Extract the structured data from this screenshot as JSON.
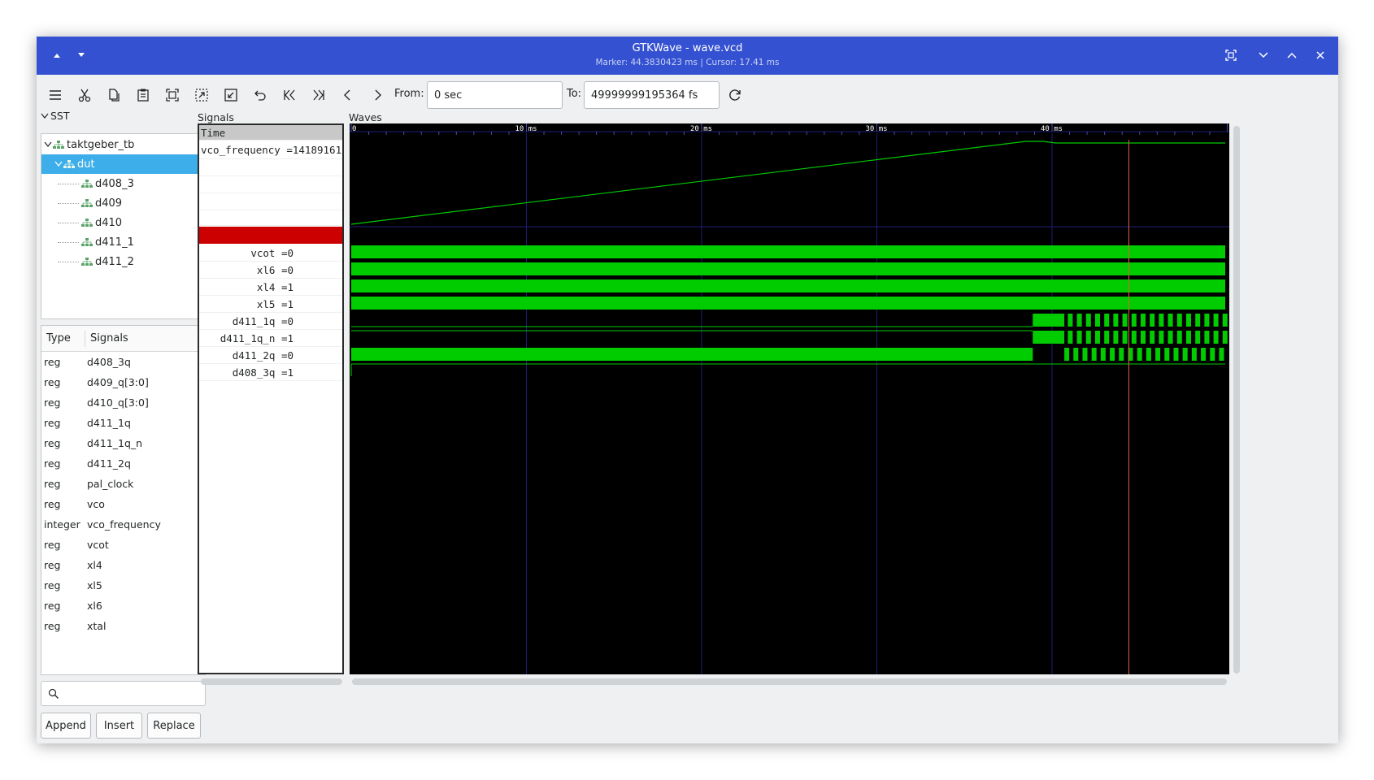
{
  "window": {
    "title": "GTKWave - wave.vcd",
    "subtitle": "Marker: 44.3830423 ms  |  Cursor: 17.41 ms"
  },
  "toolbar": {
    "from_label": "From:",
    "from_value": "0 sec",
    "to_label": "To:",
    "to_value": "49999999195364 fs"
  },
  "sst": {
    "label": "SST",
    "tree": [
      {
        "label": "taktgeber_tb",
        "level": 0,
        "expanded": true,
        "selected": false
      },
      {
        "label": "dut",
        "level": 1,
        "expanded": true,
        "selected": true
      },
      {
        "label": "d408_3",
        "level": 2,
        "selected": false
      },
      {
        "label": "d409",
        "level": 2,
        "selected": false
      },
      {
        "label": "d410",
        "level": 2,
        "selected": false
      },
      {
        "label": "d411_1",
        "level": 2,
        "selected": false
      },
      {
        "label": "d411_2",
        "level": 2,
        "selected": false
      }
    ],
    "columns": {
      "type": "Type",
      "signals": "Signals"
    },
    "signals": [
      {
        "type": "reg",
        "name": "d408_3q"
      },
      {
        "type": "reg",
        "name": "d409_q[3:0]"
      },
      {
        "type": "reg",
        "name": "d410_q[3:0]"
      },
      {
        "type": "reg",
        "name": "d411_1q"
      },
      {
        "type": "reg",
        "name": "d411_1q_n"
      },
      {
        "type": "reg",
        "name": "d411_2q"
      },
      {
        "type": "reg",
        "name": "pal_clock"
      },
      {
        "type": "reg",
        "name": "vco"
      },
      {
        "type": "integer",
        "name": "vco_frequency"
      },
      {
        "type": "reg",
        "name": "vcot"
      },
      {
        "type": "reg",
        "name": "xl4"
      },
      {
        "type": "reg",
        "name": "xl5"
      },
      {
        "type": "reg",
        "name": "xl6"
      },
      {
        "type": "reg",
        "name": "xtal"
      }
    ],
    "buttons": {
      "append": "Append",
      "insert": "Insert",
      "replace": "Replace"
    }
  },
  "signals_panel": {
    "label": "Signals",
    "time_header": "Time",
    "analog": "vco_frequency =14189161",
    "digital": [
      "vcot =0",
      "xl6 =0",
      "xl4 =1",
      "xl5 =1",
      "d411_1q =0",
      "d411_1q_n =1",
      "d411_2q =0",
      "d408_3q =1"
    ]
  },
  "waves": {
    "label": "Waves",
    "ticks": [
      "0",
      "10 ms",
      "20 ms",
      "30 ms",
      "40 ms"
    ],
    "range_ms": [
      0,
      50
    ],
    "marker_ms": 44.3830423,
    "colors": {
      "trace": "#00cc00",
      "bg": "#000000",
      "grid": "#1e1e7a",
      "marker": "#e06040",
      "highlight": "#cc0000"
    }
  }
}
